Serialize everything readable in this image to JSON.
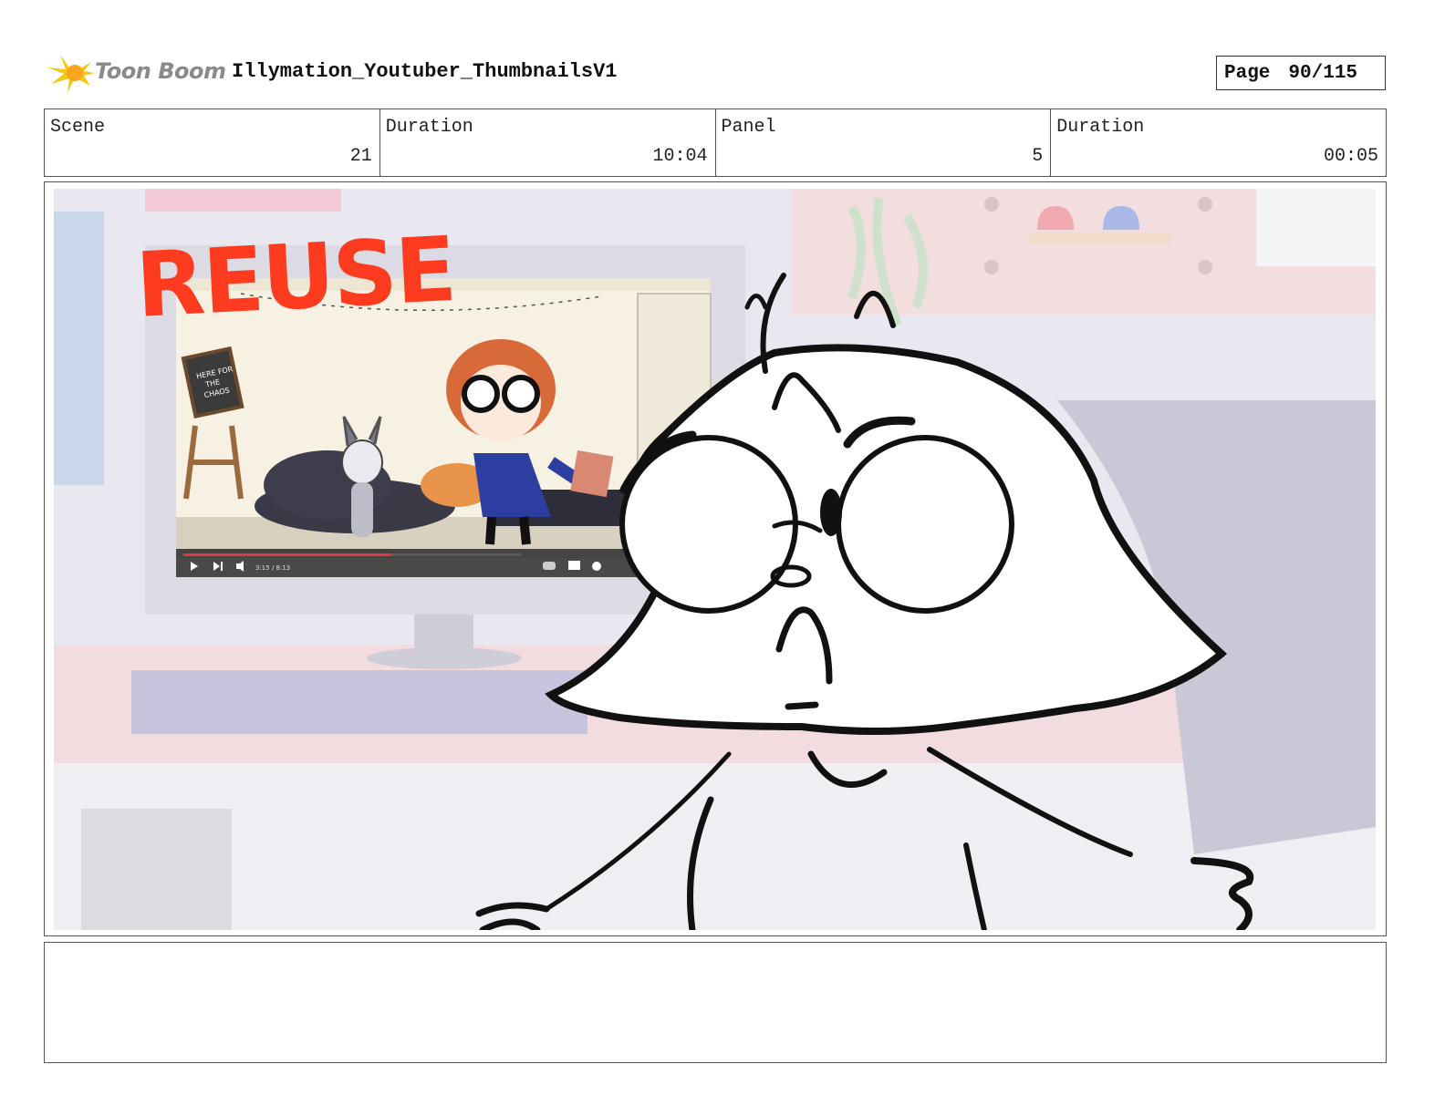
{
  "header": {
    "logo_text": "Toon Boom",
    "title": "Illymation_Youtuber_ThumbnailsV1",
    "page_label": "Page",
    "page_value": "90/115"
  },
  "info": [
    {
      "label": "Scene",
      "value": "21"
    },
    {
      "label": "Duration",
      "value": "10:04"
    },
    {
      "label": "Panel",
      "value": "5"
    },
    {
      "label": "Duration",
      "value": "00:05"
    }
  ],
  "panel": {
    "overlay_text": "REUSE",
    "video_time": "3:15 / 8:13",
    "chalkboard_text": [
      "HERE FOR",
      "THE",
      "CHAOS"
    ]
  },
  "colors": {
    "reuse_red": "#ff3b1f",
    "logo_yellow": "#f5c518",
    "progress_red": "#e5334b"
  },
  "notes": ""
}
